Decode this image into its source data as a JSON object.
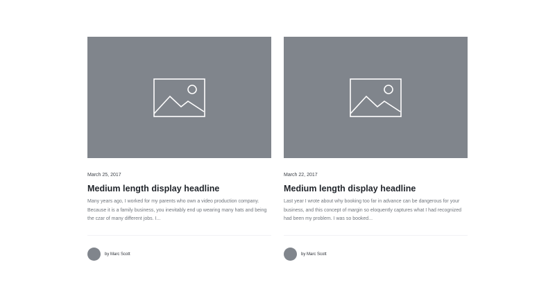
{
  "posts": [
    {
      "image_icon": "image-placeholder-icon",
      "date": "March 25, 2017",
      "headline": "Medium length display headline",
      "excerpt": "Many years ago, I worked for my parents who own a video production company. Because it is a family business, you inevitably end up wearing many hats and being the czar of many different jobs. I...",
      "author": "by Marc Scott"
    },
    {
      "image_icon": "image-placeholder-icon",
      "date": "March 22, 2017",
      "headline": "Medium length display headline",
      "excerpt": "Last year I wrote about why booking too far in advance can be dangerous for your business, and this concept of margin so eloquently captures what I had recognized had been my problem. I was so booked...",
      "author": "by Marc Scott"
    }
  ],
  "colors": {
    "placeholder": "#80858c",
    "headline": "#1f2329",
    "excerpt": "#70757c"
  }
}
